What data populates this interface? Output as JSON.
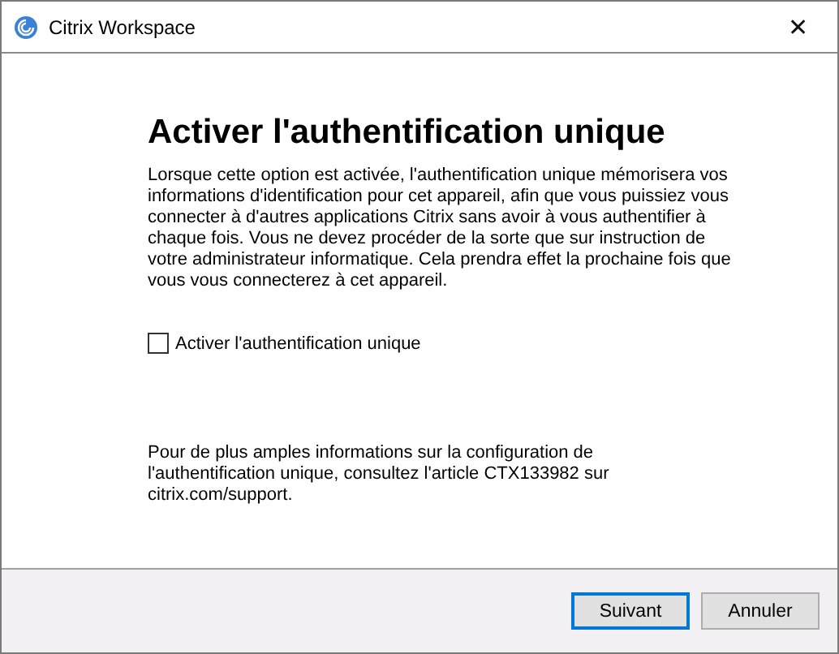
{
  "window": {
    "title": "Citrix Workspace",
    "close": "✕"
  },
  "heading": "Activer l'authentification unique",
  "description": "Lorsque cette option est activée, l'authentification unique mémorisera vos informations d'identification pour cet appareil, afin que vous puissiez vous connecter à d'autres applications Citrix sans avoir à vous authentifier à chaque fois. Vous ne devez procéder de la sorte que sur instruction de votre administrateur informatique. Cela prendra effet la prochaine fois que vous vous connecterez à cet appareil.",
  "option": {
    "label": "Activer l'authentification unique",
    "checked": false
  },
  "info": "Pour de plus amples informations sur la configuration de l'authentification unique, consultez l'article CTX133982 sur citrix.com/support.",
  "buttons": [
    {
      "label": "Suivant",
      "default": true
    },
    {
      "label": "Annuler",
      "default": false
    }
  ]
}
